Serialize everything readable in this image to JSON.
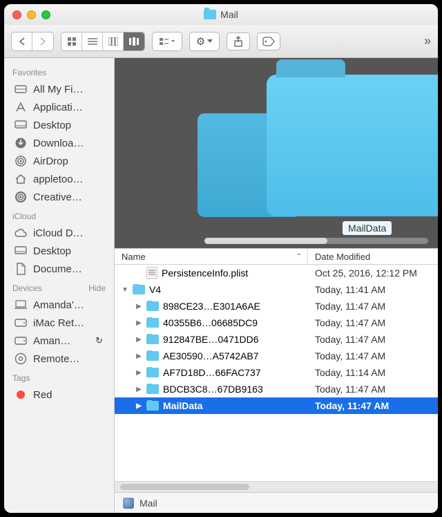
{
  "window": {
    "title": "Mail"
  },
  "cover": {
    "caption": "MailData"
  },
  "columns": {
    "name": "Name",
    "date": "Date Modified"
  },
  "sidebar": {
    "sections": [
      {
        "title": "Favorites",
        "items": [
          {
            "icon": "disk",
            "label": "All My Fi…"
          },
          {
            "icon": "apps",
            "label": "Applicati…"
          },
          {
            "icon": "desktop",
            "label": "Desktop"
          },
          {
            "icon": "download",
            "label": "Downloa…"
          },
          {
            "icon": "airdrop",
            "label": "AirDrop"
          },
          {
            "icon": "home",
            "label": "appletoo…"
          },
          {
            "icon": "cc",
            "label": "Creative…"
          }
        ]
      },
      {
        "title": "iCloud",
        "items": [
          {
            "icon": "cloud",
            "label": "iCloud D…"
          },
          {
            "icon": "desktop",
            "label": "Desktop"
          },
          {
            "icon": "docs",
            "label": "Docume…"
          }
        ]
      },
      {
        "title": "Devices",
        "action": "Hide",
        "items": [
          {
            "icon": "laptop",
            "label": "Amanda'…"
          },
          {
            "icon": "hd",
            "label": "iMac Ret…"
          },
          {
            "icon": "hd",
            "label": "Aman…",
            "sync": true
          },
          {
            "icon": "remote",
            "label": "Remote…"
          }
        ]
      },
      {
        "title": "Tags",
        "items": [
          {
            "icon": "tagred",
            "label": "Red"
          }
        ]
      }
    ]
  },
  "files": [
    {
      "indent": 1,
      "kind": "plist",
      "disc": "",
      "name": "PersistenceInfo.plist",
      "date": "Oct 25, 2016, 12:12 PM"
    },
    {
      "indent": 0,
      "kind": "folder",
      "disc": "down",
      "name": "V4",
      "date": "Today, 11:41 AM"
    },
    {
      "indent": 1,
      "kind": "folder",
      "disc": "right",
      "name": "898CE23…E301A6AE",
      "date": "Today, 11:47 AM"
    },
    {
      "indent": 1,
      "kind": "folder",
      "disc": "right",
      "name": "40355B6…06685DC9",
      "date": "Today, 11:47 AM"
    },
    {
      "indent": 1,
      "kind": "folder",
      "disc": "right",
      "name": "912847BE…0471DD6",
      "date": "Today, 11:47 AM"
    },
    {
      "indent": 1,
      "kind": "folder",
      "disc": "right",
      "name": "AE30590…A5742AB7",
      "date": "Today, 11:47 AM"
    },
    {
      "indent": 1,
      "kind": "folder",
      "disc": "right",
      "name": "AF7D18D…66FAC737",
      "date": "Today, 11:14 AM"
    },
    {
      "indent": 1,
      "kind": "folder",
      "disc": "right",
      "name": "BDCB3C8…67DB9163",
      "date": "Today, 11:47 AM"
    },
    {
      "indent": 1,
      "kind": "folder",
      "disc": "right",
      "name": "MailData",
      "date": "Today, 11:47 AM",
      "selected": true
    }
  ],
  "pathbar": {
    "label": "Mail"
  }
}
